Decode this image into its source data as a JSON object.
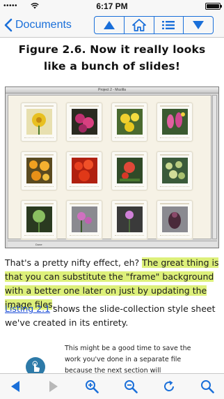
{
  "status_bar": {
    "carrier": "•••••",
    "time": "6:17 PM"
  },
  "nav": {
    "back_label": "Documents"
  },
  "content": {
    "figure_title": "Figure 2.6. Now it really looks like a bunch of slides!",
    "browser_window_title": "Project 2 - Mozilla",
    "browser_status": "Done",
    "para1_prefix": "That's a pretty nifty effect, eh? ",
    "para1_highlight": "The great thing is that you can substitute the \"frame\" background with a better one later on just by updating the image files",
    "para1_suffix": ".",
    "para2_link": "Listing 2.1",
    "para2_rest": " shows the slide-collection style sheet we've created in its entirety.",
    "note_text": "This might be a good time to save the work you've done in a separate file because the next section will"
  },
  "colors": {
    "accent": "#1a6fd9",
    "highlight": "#ddf07a",
    "link": "#1a4bd6"
  },
  "icons": {
    "nav": [
      "back-chevron-icon",
      "up-arrow-icon",
      "home-icon",
      "list-icon",
      "down-arrow-icon"
    ],
    "toolbar": [
      "prev-page-icon",
      "next-page-icon",
      "zoom-in-icon",
      "zoom-out-icon",
      "refresh-icon",
      "search-icon"
    ],
    "note": "touch-hand-icon"
  }
}
